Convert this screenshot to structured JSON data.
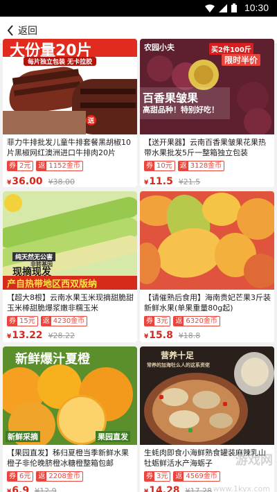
{
  "status_bar": {
    "time": "10:30"
  },
  "nav": {
    "back_label": "返回"
  },
  "products": [
    {
      "title": "菲力牛排批发儿童牛排套餐黑胡椒10片黑椒网红澳洲进口牛排肉20片",
      "coupon_label": "券",
      "coupon_value": "2元",
      "rebate_label": "返",
      "rebate_value": "1152金币",
      "price": "36.00",
      "original_price": "¥38.00",
      "image_text": [
        "大份量20片",
        "每片独立包装 无卡拉胶",
        "送"
      ]
    },
    {
      "title": "【送开果器】云南百香果皱果花果热带水果批发5斤一整箱独立包装",
      "coupon_label": "券",
      "coupon_value": "10元",
      "rebate_label": "返",
      "rebate_value": "3128金币",
      "price": "11.5",
      "original_price": "¥21.5",
      "image_text": [
        "农园小夫",
        "买2件100斤",
        "限时半价",
        "百香果皱果",
        "高甜品种！特别好吃！"
      ]
    },
    {
      "title": "【超大8根】云南水果玉米现摘甜脆甜玉米棒甜脆爆浆嫩非糯玉米",
      "coupon_label": "券",
      "coupon_value": "15元",
      "rebate_label": "返",
      "rebate_value": "4230金币",
      "price": "13.22",
      "original_price": "¥28.22",
      "image_text": [
        "纯天然无公害",
        "非转基因",
        "现摘现发",
        "产自热带地区西双版纳"
      ]
    },
    {
      "title": "【请催熟后食用】海南贵妃芒果3斤装新鲜水果(单果重量80g起)",
      "coupon_label": "券",
      "coupon_value": "3元",
      "rebate_label": "返",
      "rebate_value": "6320金币",
      "price": "15.8",
      "original_price": "¥18.8",
      "image_text": []
    },
    {
      "title": "【果园直发】秭归夏橙当季新鲜水果橙子非伦晚脐橙冰糖橙整箱包邮",
      "coupon_label": "券",
      "coupon_value": "6元",
      "rebate_label": "返",
      "rebate_value": "2208金币",
      "price": "6.9",
      "original_price": "¥12.9",
      "image_text": [
        "新鲜爆汁夏橙",
        "新鲜采摘",
        "果园直发"
      ]
    },
    {
      "title": "生蚝肉即食小海鲜熟食罐装麻辣乳山牡蛎鲜活水产海蛎子",
      "coupon_label": "券",
      "coupon_value": "3元",
      "rebate_label": "返",
      "rebate_value": "4569金币",
      "price": "14.28",
      "original_price": "¥17.28",
      "image_text": [
        "营养十足",
        "常养的加海牡么人的这系资佬"
      ]
    }
  ],
  "watermark": {
    "brand": "游戏网",
    "url": "www.1kyx.com"
  },
  "colors": {
    "price_red": "#d3291e",
    "badge_red": "#e8453c",
    "status_bar": "#000000"
  }
}
